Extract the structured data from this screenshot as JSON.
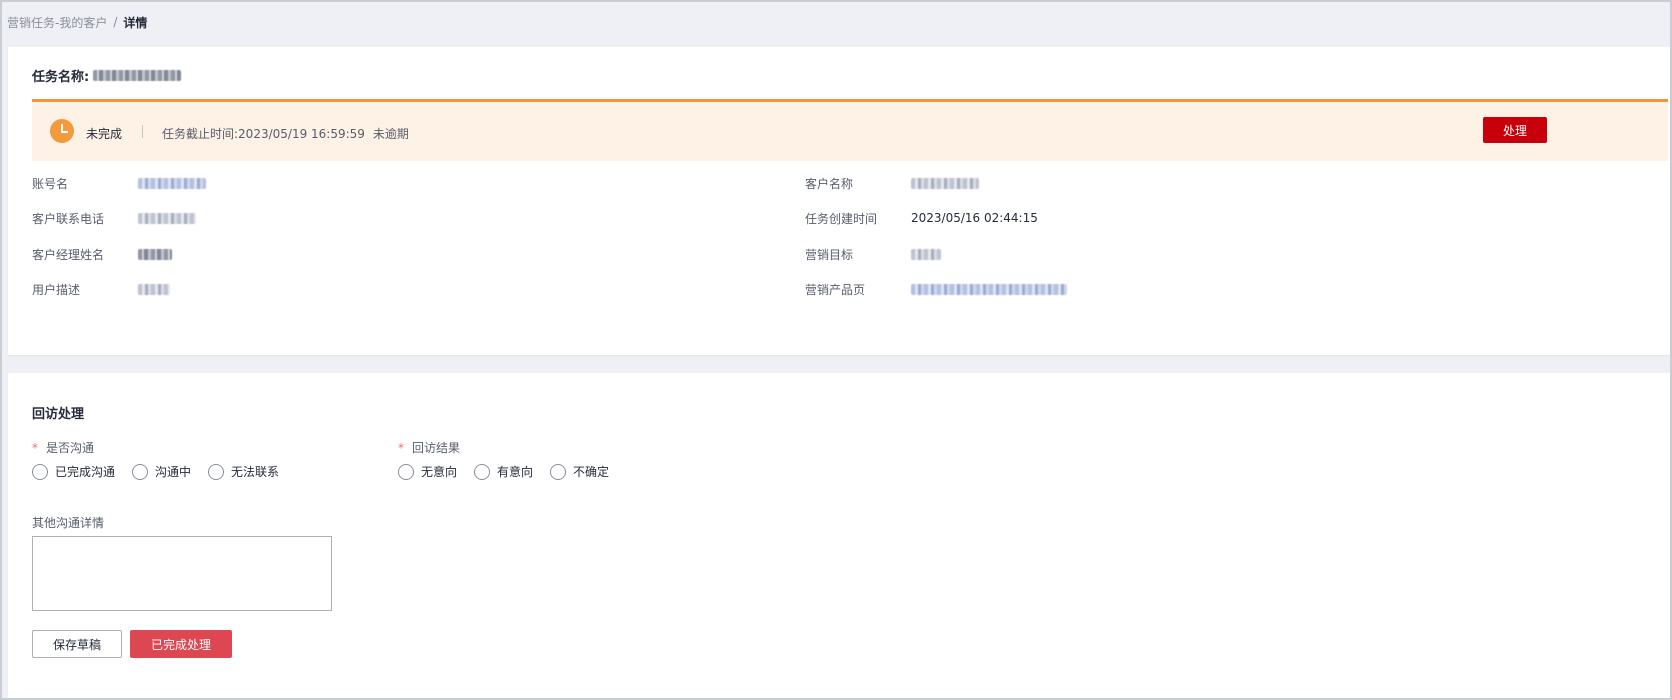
{
  "breadcrumb": {
    "parent": "营销任务-我的客户",
    "separator": "/",
    "current": "详情"
  },
  "task": {
    "title_label": "任务名称:",
    "title_value_redacted": true
  },
  "status": {
    "state": "未完成",
    "deadline_label": "任务截止时间:",
    "deadline_value": "2023/05/19 16:59:59",
    "overdue_status": "未逾期",
    "action_button": "处理",
    "icon": "clock-icon",
    "accent_color": "#f0953c",
    "background_color": "#fef1e5"
  },
  "info": {
    "left": [
      {
        "label": "账号名",
        "redacted": true
      },
      {
        "label": "客户联系电话",
        "redacted": true
      },
      {
        "label": "客户经理姓名",
        "redacted": true
      },
      {
        "label": "用户描述",
        "redacted": true
      }
    ],
    "right": [
      {
        "label": "客户名称",
        "redacted": true
      },
      {
        "label": "任务创建时间",
        "value": "2023/05/16 02:44:15"
      },
      {
        "label": "营销目标",
        "redacted": true
      },
      {
        "label": "营销产品页",
        "redacted": true
      }
    ]
  },
  "followup": {
    "section_title": "回访处理",
    "communicated": {
      "required_mark": "*",
      "label": "是否沟通",
      "options": [
        "已完成沟通",
        "沟通中",
        "无法联系"
      ]
    },
    "result": {
      "required_mark": "*",
      "label": "回访结果",
      "options": [
        "无意向",
        "有意向",
        "不确定"
      ]
    },
    "details_label": "其他沟通详情",
    "details_value": "",
    "save_draft_button": "保存草稿",
    "complete_button": "已完成处理",
    "primary_color": "#dc4752"
  }
}
